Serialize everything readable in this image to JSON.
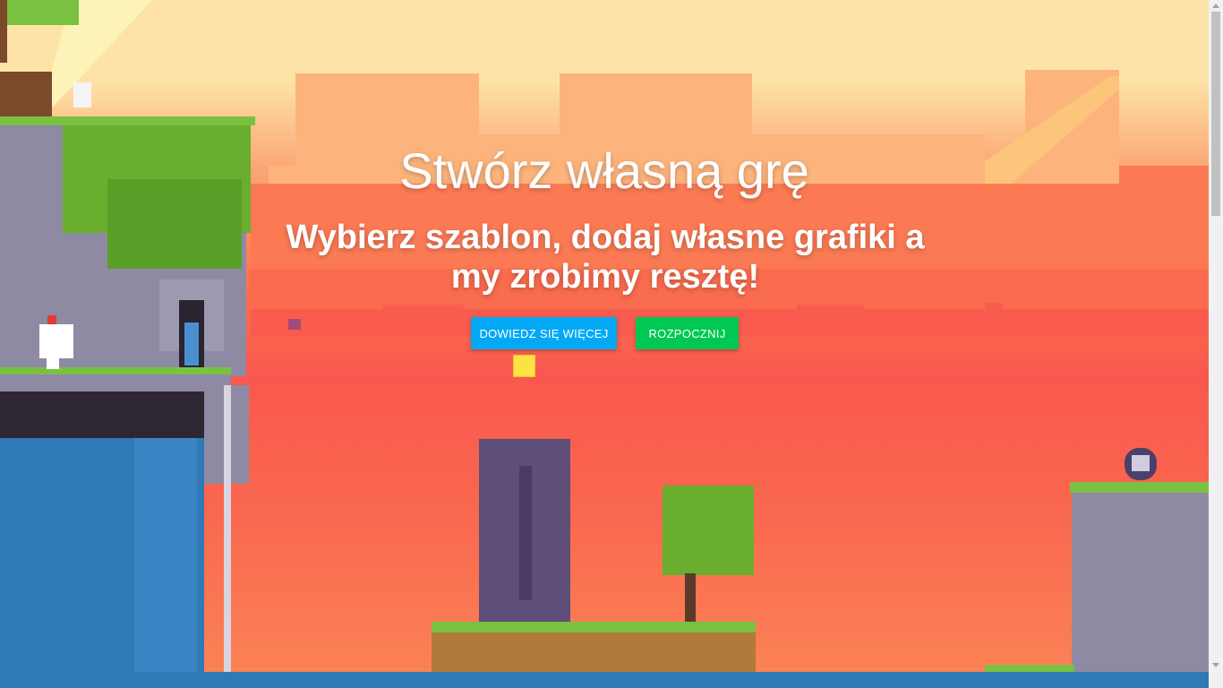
{
  "hero": {
    "title": "Stwórz własną grę",
    "subtitle": "Wybierz szablon, dodaj własne grafiki a my zrobimy resztę!",
    "buttons": {
      "learn_more": "DOWIEDZ SIĘ WIĘCEJ",
      "start": "ROZPOCZNIJ"
    }
  },
  "colors": {
    "learn_more_button": "#03a9f4",
    "start_button": "#00c853",
    "sky_top": "#fde3a7",
    "sky_bottom": "#f9584e",
    "grass": "#7ac142",
    "stone": "#8e8aa3",
    "water": "#2f79b6"
  },
  "icons": {
    "player": "white-pixel-character-icon",
    "bird": "white-bird-icon",
    "enemy": "skull-bomb-icon",
    "collectible": "yellow-cube-icon"
  }
}
